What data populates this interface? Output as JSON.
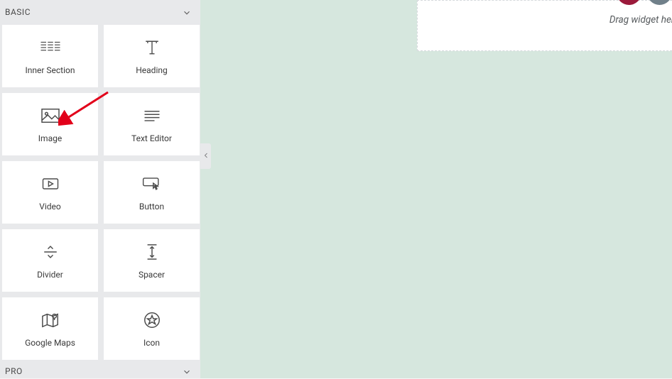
{
  "sidebar": {
    "categories": [
      {
        "label": "BASIC"
      },
      {
        "label": "PRO"
      }
    ],
    "widgets": [
      {
        "name": "inner-section",
        "label": "Inner Section",
        "icon": "inner-section-icon"
      },
      {
        "name": "heading",
        "label": "Heading",
        "icon": "heading-icon"
      },
      {
        "name": "image",
        "label": "Image",
        "icon": "image-icon"
      },
      {
        "name": "text-editor",
        "label": "Text Editor",
        "icon": "text-editor-icon"
      },
      {
        "name": "video",
        "label": "Video",
        "icon": "video-icon"
      },
      {
        "name": "button",
        "label": "Button",
        "icon": "button-icon"
      },
      {
        "name": "divider",
        "label": "Divider",
        "icon": "divider-icon"
      },
      {
        "name": "spacer",
        "label": "Spacer",
        "icon": "spacer-icon"
      },
      {
        "name": "google-maps",
        "label": "Google Maps",
        "icon": "google-maps-icon"
      },
      {
        "name": "icon",
        "label": "Icon",
        "icon": "icon-icon"
      }
    ]
  },
  "canvas": {
    "dropzone_text": "Drag widget here"
  }
}
